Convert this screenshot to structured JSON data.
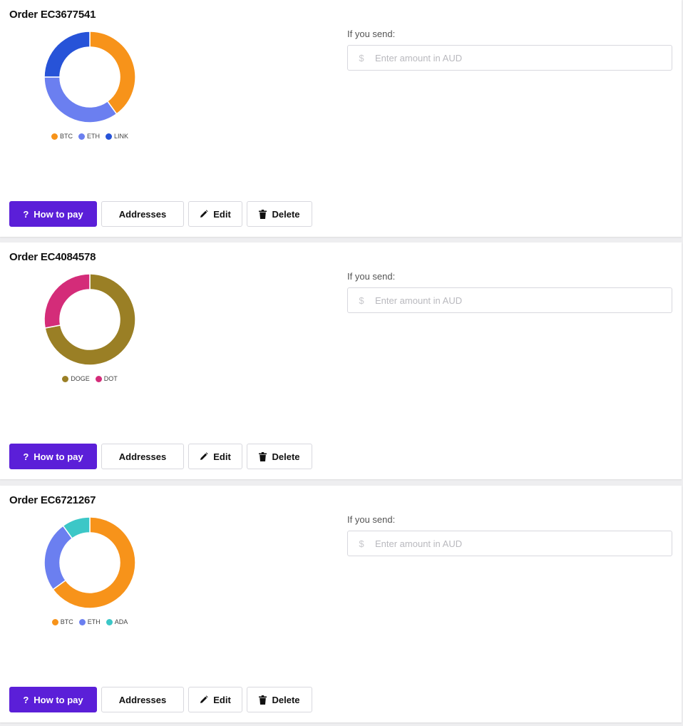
{
  "amount_label": "If you send:",
  "amount_placeholder": "Enter amount in AUD",
  "currency_symbol": "$",
  "buttons": {
    "how_to_pay": "How to pay",
    "addresses": "Addresses",
    "edit": "Edit",
    "delete": "Delete"
  },
  "icons": {
    "how_to_pay": "question-icon",
    "edit": "pencil-icon",
    "delete": "trash-icon"
  },
  "orders": [
    {
      "title": "Order EC3677541",
      "chart_data": {
        "type": "pie",
        "style": "donut",
        "labels": [
          "BTC",
          "ETH",
          "LINK"
        ],
        "values": [
          40,
          35,
          25
        ],
        "colors": [
          "#f7931a",
          "#6b7ff0",
          "#2753d8"
        ],
        "legend": "bottom"
      }
    },
    {
      "title": "Order EC4084578",
      "chart_data": {
        "type": "pie",
        "style": "donut",
        "labels": [
          "DOGE",
          "DOT"
        ],
        "values": [
          72,
          28
        ],
        "colors": [
          "#9a7f25",
          "#d42c79"
        ],
        "legend": "bottom"
      }
    },
    {
      "title": "Order EC6721267",
      "chart_data": {
        "type": "pie",
        "style": "donut",
        "labels": [
          "BTC",
          "ETH",
          "ADA"
        ],
        "values": [
          65,
          25,
          10
        ],
        "colors": [
          "#f7931a",
          "#6b7ff0",
          "#3cc7c7"
        ],
        "legend": "bottom"
      }
    }
  ]
}
